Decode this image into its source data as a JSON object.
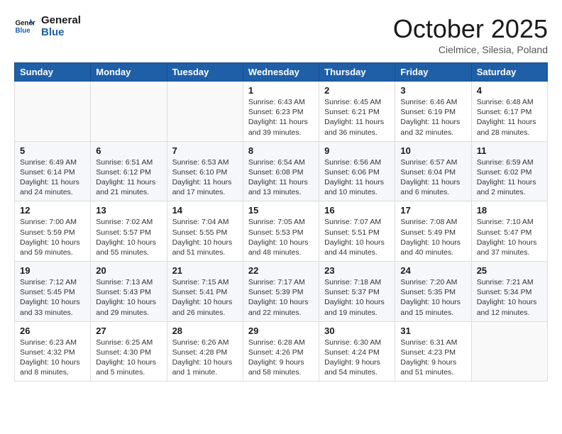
{
  "header": {
    "logo_general": "General",
    "logo_blue": "Blue",
    "month": "October 2025",
    "location": "Cielmice, Silesia, Poland"
  },
  "days_of_week": [
    "Sunday",
    "Monday",
    "Tuesday",
    "Wednesday",
    "Thursday",
    "Friday",
    "Saturday"
  ],
  "weeks": [
    [
      {
        "day": "",
        "info": ""
      },
      {
        "day": "",
        "info": ""
      },
      {
        "day": "",
        "info": ""
      },
      {
        "day": "1",
        "info": "Sunrise: 6:43 AM\nSunset: 6:23 PM\nDaylight: 11 hours\nand 39 minutes."
      },
      {
        "day": "2",
        "info": "Sunrise: 6:45 AM\nSunset: 6:21 PM\nDaylight: 11 hours\nand 36 minutes."
      },
      {
        "day": "3",
        "info": "Sunrise: 6:46 AM\nSunset: 6:19 PM\nDaylight: 11 hours\nand 32 minutes."
      },
      {
        "day": "4",
        "info": "Sunrise: 6:48 AM\nSunset: 6:17 PM\nDaylight: 11 hours\nand 28 minutes."
      }
    ],
    [
      {
        "day": "5",
        "info": "Sunrise: 6:49 AM\nSunset: 6:14 PM\nDaylight: 11 hours\nand 24 minutes."
      },
      {
        "day": "6",
        "info": "Sunrise: 6:51 AM\nSunset: 6:12 PM\nDaylight: 11 hours\nand 21 minutes."
      },
      {
        "day": "7",
        "info": "Sunrise: 6:53 AM\nSunset: 6:10 PM\nDaylight: 11 hours\nand 17 minutes."
      },
      {
        "day": "8",
        "info": "Sunrise: 6:54 AM\nSunset: 6:08 PM\nDaylight: 11 hours\nand 13 minutes."
      },
      {
        "day": "9",
        "info": "Sunrise: 6:56 AM\nSunset: 6:06 PM\nDaylight: 11 hours\nand 10 minutes."
      },
      {
        "day": "10",
        "info": "Sunrise: 6:57 AM\nSunset: 6:04 PM\nDaylight: 11 hours\nand 6 minutes."
      },
      {
        "day": "11",
        "info": "Sunrise: 6:59 AM\nSunset: 6:02 PM\nDaylight: 11 hours\nand 2 minutes."
      }
    ],
    [
      {
        "day": "12",
        "info": "Sunrise: 7:00 AM\nSunset: 5:59 PM\nDaylight: 10 hours\nand 59 minutes."
      },
      {
        "day": "13",
        "info": "Sunrise: 7:02 AM\nSunset: 5:57 PM\nDaylight: 10 hours\nand 55 minutes."
      },
      {
        "day": "14",
        "info": "Sunrise: 7:04 AM\nSunset: 5:55 PM\nDaylight: 10 hours\nand 51 minutes."
      },
      {
        "day": "15",
        "info": "Sunrise: 7:05 AM\nSunset: 5:53 PM\nDaylight: 10 hours\nand 48 minutes."
      },
      {
        "day": "16",
        "info": "Sunrise: 7:07 AM\nSunset: 5:51 PM\nDaylight: 10 hours\nand 44 minutes."
      },
      {
        "day": "17",
        "info": "Sunrise: 7:08 AM\nSunset: 5:49 PM\nDaylight: 10 hours\nand 40 minutes."
      },
      {
        "day": "18",
        "info": "Sunrise: 7:10 AM\nSunset: 5:47 PM\nDaylight: 10 hours\nand 37 minutes."
      }
    ],
    [
      {
        "day": "19",
        "info": "Sunrise: 7:12 AM\nSunset: 5:45 PM\nDaylight: 10 hours\nand 33 minutes."
      },
      {
        "day": "20",
        "info": "Sunrise: 7:13 AM\nSunset: 5:43 PM\nDaylight: 10 hours\nand 29 minutes."
      },
      {
        "day": "21",
        "info": "Sunrise: 7:15 AM\nSunset: 5:41 PM\nDaylight: 10 hours\nand 26 minutes."
      },
      {
        "day": "22",
        "info": "Sunrise: 7:17 AM\nSunset: 5:39 PM\nDaylight: 10 hours\nand 22 minutes."
      },
      {
        "day": "23",
        "info": "Sunrise: 7:18 AM\nSunset: 5:37 PM\nDaylight: 10 hours\nand 19 minutes."
      },
      {
        "day": "24",
        "info": "Sunrise: 7:20 AM\nSunset: 5:35 PM\nDaylight: 10 hours\nand 15 minutes."
      },
      {
        "day": "25",
        "info": "Sunrise: 7:21 AM\nSunset: 5:34 PM\nDaylight: 10 hours\nand 12 minutes."
      }
    ],
    [
      {
        "day": "26",
        "info": "Sunrise: 6:23 AM\nSunset: 4:32 PM\nDaylight: 10 hours\nand 8 minutes."
      },
      {
        "day": "27",
        "info": "Sunrise: 6:25 AM\nSunset: 4:30 PM\nDaylight: 10 hours\nand 5 minutes."
      },
      {
        "day": "28",
        "info": "Sunrise: 6:26 AM\nSunset: 4:28 PM\nDaylight: 10 hours\nand 1 minute."
      },
      {
        "day": "29",
        "info": "Sunrise: 6:28 AM\nSunset: 4:26 PM\nDaylight: 9 hours\nand 58 minutes."
      },
      {
        "day": "30",
        "info": "Sunrise: 6:30 AM\nSunset: 4:24 PM\nDaylight: 9 hours\nand 54 minutes."
      },
      {
        "day": "31",
        "info": "Sunrise: 6:31 AM\nSunset: 4:23 PM\nDaylight: 9 hours\nand 51 minutes."
      },
      {
        "day": "",
        "info": ""
      }
    ]
  ]
}
